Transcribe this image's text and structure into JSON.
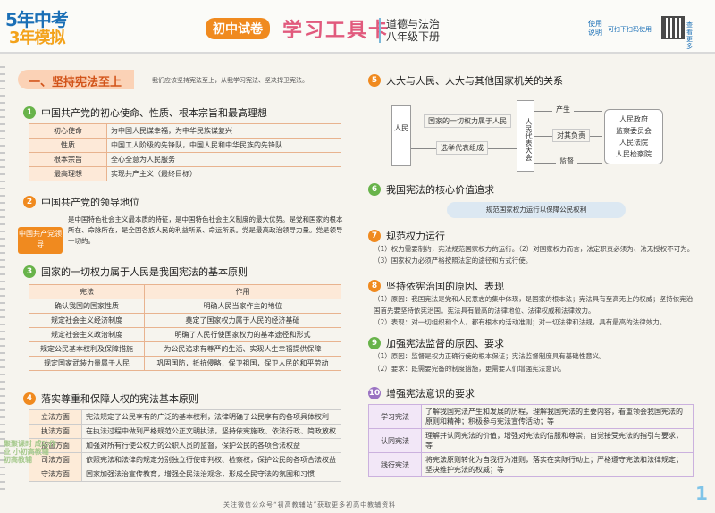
{
  "header": {
    "logo_line1": "5年中考",
    "logo_line2": "3年模拟",
    "badge_test": "初中试卷",
    "badge_card": "学习工具卡",
    "subject": "道德与法治",
    "grade": "八年级下册",
    "qr_use": "使用说明",
    "qr_hint": "可扫下扫码使用",
    "qr_side": "查看更多"
  },
  "banner": {
    "title": "一、坚持宪法至上",
    "subtitle": "我们应该坚持宪法至上，从我学习宪法、坚决捍卫宪法。"
  },
  "left": {
    "s1": {
      "num": "1",
      "title": "中国共产党的初心使命、性质、根本宗旨和最高理想",
      "rows": [
        {
          "k": "初心使命",
          "v": "为中国人民谋幸福，为中华民族谋复兴"
        },
        {
          "k": "性质",
          "v": "中国工人阶级的先锋队，中国人民和中华民族的先锋队"
        },
        {
          "k": "根本宗旨",
          "v": "全心全意为人民服务"
        },
        {
          "k": "最高理想",
          "v": "实现共产主义（最终目标）"
        }
      ]
    },
    "s2": {
      "num": "2",
      "title": "中国共产党的领导地位",
      "label": "中国共产党领导",
      "text": "是中国特色社会主义最本质的特征，是中国特色社会主义制度的最大优势。是党和国家的根本所在、命脉所在，是全国各族人民的利益所系、命运所系。党是最高政治领导力量。党是领导一切的。"
    },
    "s3": {
      "num": "3",
      "title": "国家的一切权力属于人民是我国宪法的基本原则",
      "head": [
        "宪法",
        "作用"
      ],
      "rows": [
        [
          "确认我国的国家性质",
          "明确人民当家作主的地位"
        ],
        [
          "规定社会主义经济制度",
          "奠定了国家权力属于人民的经济基础"
        ],
        [
          "规定社会主义政治制度",
          "明确了人民行使国家权力的基本途径和形式"
        ],
        [
          "规定公民基本权利及保障措施",
          "为公民追求有尊严的生活、实现人生幸福提供保障"
        ],
        [
          "规定国家武装力量属于人民",
          "巩固国防，抵抗侵略，保卫祖国，保卫人民的和平劳动"
        ]
      ]
    },
    "s4": {
      "num": "4",
      "title": "落实尊重和保障人权的宪法基本原则",
      "rows": [
        {
          "k": "立法方面",
          "v": "宪法规定了公民享有的广泛的基本权利，法律明确了公民享有的各项具体权利"
        },
        {
          "k": "执法方面",
          "v": "在执法过程中做到严格规范公正文明执法，坚持依宪施政、依法行政、简政放权"
        },
        {
          "k": "监督方面",
          "v": "加强对所有行使公权力的公职人员的监督，保护公民的各项合法权益"
        },
        {
          "k": "司法方面",
          "v": "依照宪法和法律的规定分别独立行使审判权、检察权，保护公民的各项合法权益"
        },
        {
          "k": "守法方面",
          "v": "国家加强法治宣传教育，增强全民法治观念，形成全民守法的氛围和习惯"
        }
      ]
    },
    "watermark": "聚聚课时 成功作业 小初高教辅 初高教辅"
  },
  "right": {
    "s5": {
      "num": "5",
      "title": "人大与人民、人大与其他国家机关的关系",
      "people": "人民",
      "npc": "人民代表大会",
      "arrow_up": "国家的一切权力属于人民",
      "arrow_down": "选举代表组成",
      "r1": "产生",
      "r2": "对其负责",
      "r3": "监督",
      "organs": [
        "人民政府",
        "监察委员会",
        "人民法院",
        "人民检察院"
      ]
    },
    "s6": {
      "num": "6",
      "title": "我国宪法的核心价值追求",
      "text": "规范国家权力运行以保障公民权利"
    },
    "s7": {
      "num": "7",
      "title": "规范权力运行",
      "text": "（1）权力需要制约，宪法规范国家权力的运行。（2）对国家权力而言，法定职责必须为、法无授权不可为。（3）国家权力必须严格按照法定的途径和方式行使。"
    },
    "s8": {
      "num": "8",
      "title": "坚持依宪治国的原因、表现",
      "text1": "（1）原因：我国宪法是党和人民意志的集中体现，是国家的根本法；宪法具有至高无上的权威；坚持依宪治国首先要坚持依宪治国。宪法具有最高的法律地位、法律权威和法律效力。",
      "text2": "（2）表现：对一切组织和个人，都有根本的活动准则；对一切法律和法规，具有最高的法律效力。"
    },
    "s9": {
      "num": "9",
      "title": "加强宪法监督的原因、要求",
      "text1": "（1）原因：监督是权力正确行使的根本保证；宪法监督制度具有基础性意义。",
      "text2": "（2）要求：既需要完备的制度措施，更需要人们增强宪法意识。"
    },
    "s10": {
      "num": "10",
      "title": "增强宪法意识的要求",
      "rows": [
        {
          "k": "学习宪法",
          "v": "了解我国宪法产生和发展的历程，理解我国宪法的主要内容，看重领会我国宪法的原则和精神；积极参与宪法宣传活动；等"
        },
        {
          "k": "认同宪法",
          "v": "理解并认同宪法的价值，增强对宪法的信服和尊崇，自觉接受宪法的指引与要求，等"
        },
        {
          "k": "践行宪法",
          "v": "将宪法原则转化为自我行为准则，落实在实际行动上；严格遵守宪法和法律规定；坚决维护宪法的权威；等"
        }
      ]
    }
  },
  "footer": "关注微信公众号“初高教辅站”获取更多初高中教辅资料",
  "page_number": "1"
}
